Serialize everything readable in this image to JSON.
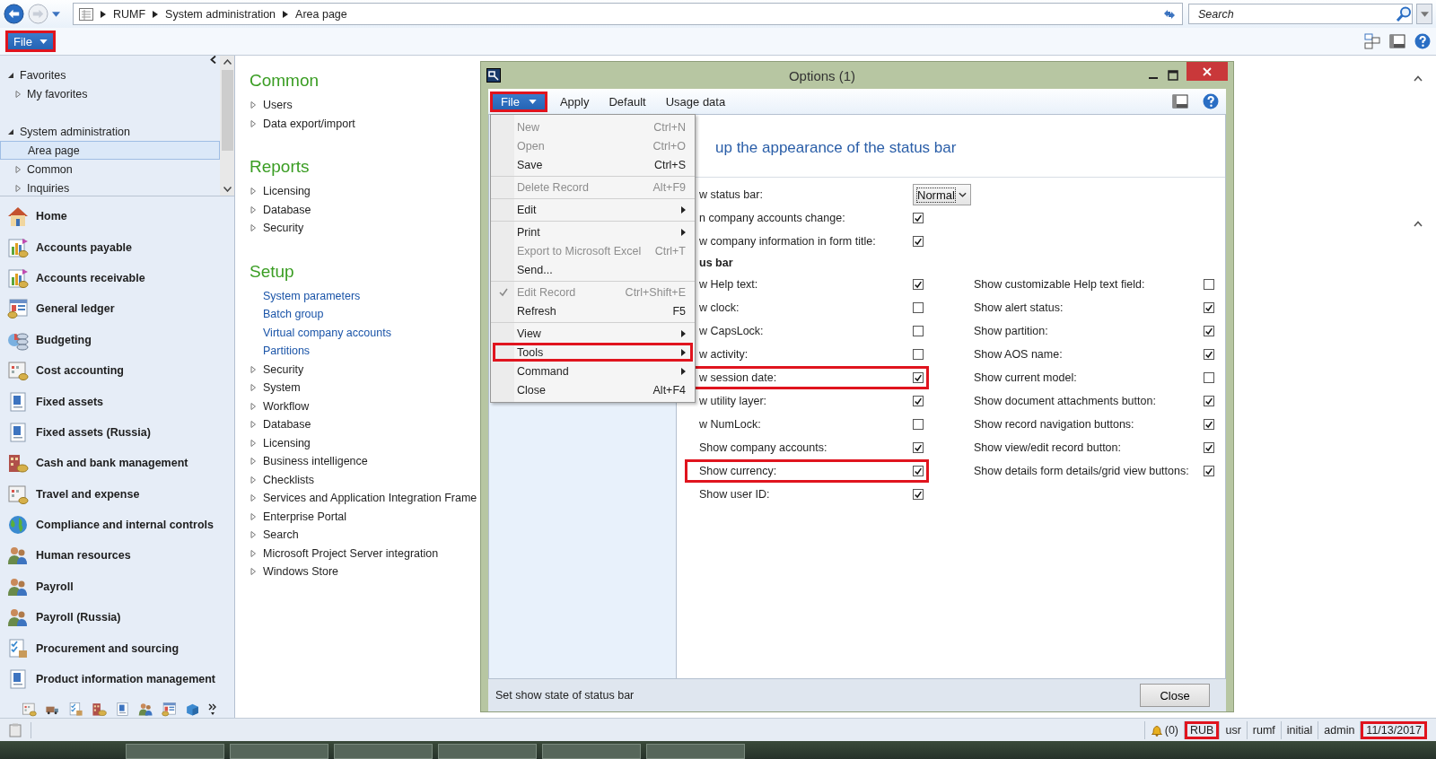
{
  "address_bar": {
    "breadcrumb": [
      "RUMF",
      "System administration",
      "Area page"
    ],
    "search": {
      "placeholder": "Search"
    }
  },
  "menu_bar": {
    "file": {
      "label": "File",
      "highlighted": true
    }
  },
  "navigation": {
    "tree": [
      {
        "label": "Favorites",
        "expanded": true,
        "children": [
          {
            "label": "My favorites",
            "expanded": false,
            "selected": false
          }
        ]
      },
      {
        "label": "System administration",
        "expanded": true,
        "children": [
          {
            "label": "Area page",
            "selected": true
          },
          {
            "label": "Common",
            "expanded": false,
            "selected": false
          },
          {
            "label": "Inquiries",
            "expanded": false,
            "selected": false
          }
        ]
      }
    ],
    "modules": [
      "Home",
      "Accounts payable",
      "Accounts receivable",
      "General ledger",
      "Budgeting",
      "Cost accounting",
      "Fixed assets",
      "Fixed assets (Russia)",
      "Cash and bank management",
      "Travel and expense",
      "Compliance and internal controls",
      "Human resources",
      "Payroll",
      "Payroll (Russia)",
      "Procurement and sourcing",
      "Product information management"
    ]
  },
  "content": {
    "sections": [
      {
        "title": "Common",
        "items": [
          {
            "label": "Users",
            "kind": "folder"
          },
          {
            "label": "Data export/import",
            "kind": "folder"
          }
        ]
      },
      {
        "title": "Reports",
        "items": [
          {
            "label": "Licensing",
            "kind": "folder"
          },
          {
            "label": "Database",
            "kind": "folder"
          },
          {
            "label": "Security",
            "kind": "folder"
          }
        ]
      },
      {
        "title": "Setup",
        "items": [
          {
            "label": "System parameters",
            "kind": "link"
          },
          {
            "label": "Batch group",
            "kind": "link"
          },
          {
            "label": "Virtual company accounts",
            "kind": "link"
          },
          {
            "label": "Partitions",
            "kind": "link"
          },
          {
            "label": "Security",
            "kind": "folder"
          },
          {
            "label": "System",
            "kind": "folder"
          },
          {
            "label": "Workflow",
            "kind": "folder"
          },
          {
            "label": "Database",
            "kind": "folder"
          },
          {
            "label": "Licensing",
            "kind": "folder"
          },
          {
            "label": "Business intelligence",
            "kind": "folder"
          },
          {
            "label": "Checklists",
            "kind": "folder"
          },
          {
            "label": "Services and Application Integration Frame",
            "kind": "folder"
          },
          {
            "label": "Enterprise Portal",
            "kind": "folder"
          },
          {
            "label": "Search",
            "kind": "folder"
          },
          {
            "label": "Microsoft Project Server integration",
            "kind": "folder"
          },
          {
            "label": "Windows Store",
            "kind": "folder"
          }
        ]
      }
    ]
  },
  "dialog": {
    "title": "Options (1)",
    "menu": [
      {
        "label": "File",
        "kind": "dropdown",
        "highlighted": true
      },
      {
        "label": "Apply",
        "kind": "command",
        "highlighted": false
      },
      {
        "label": "Default",
        "kind": "command",
        "highlighted": false
      },
      {
        "label": "Usage data",
        "kind": "command",
        "highlighted": false
      }
    ],
    "file_menu": [
      [
        {
          "label": "New",
          "shortcut": "Ctrl+N",
          "disabled": true,
          "checked": false,
          "submenu": false,
          "highlighted": false
        },
        {
          "label": "Open",
          "shortcut": "Ctrl+O",
          "disabled": true,
          "checked": false,
          "submenu": false,
          "highlighted": false
        },
        {
          "label": "Save",
          "shortcut": "Ctrl+S",
          "disabled": false,
          "checked": false,
          "submenu": false,
          "highlighted": false
        }
      ],
      [
        {
          "label": "Delete Record",
          "shortcut": "Alt+F9",
          "disabled": true,
          "checked": false,
          "submenu": false,
          "highlighted": false
        }
      ],
      [
        {
          "label": "Edit",
          "disabled": false,
          "checked": false,
          "submenu": true,
          "highlighted": false
        }
      ],
      [
        {
          "label": "Print",
          "disabled": false,
          "checked": false,
          "submenu": true,
          "highlighted": false
        },
        {
          "label": "Export to Microsoft Excel",
          "shortcut": "Ctrl+T",
          "disabled": true,
          "checked": false,
          "submenu": false,
          "highlighted": false
        },
        {
          "label": "Send...",
          "disabled": false,
          "checked": false,
          "submenu": false,
          "highlighted": false
        }
      ],
      [
        {
          "label": "Edit Record",
          "shortcut": "Ctrl+Shift+E",
          "disabled": true,
          "checked": true,
          "submenu": false,
          "highlighted": false
        },
        {
          "label": "Refresh",
          "shortcut": "F5",
          "disabled": false,
          "checked": false,
          "submenu": false,
          "highlighted": false
        }
      ],
      [
        {
          "label": "View",
          "disabled": false,
          "checked": false,
          "submenu": true,
          "highlighted": false
        },
        {
          "label": "Tools",
          "disabled": false,
          "checked": false,
          "submenu": true,
          "highlighted": true
        },
        {
          "label": "Command",
          "disabled": false,
          "checked": false,
          "submenu": true,
          "highlighted": false
        },
        {
          "label": "Close",
          "shortcut": "Alt+F4",
          "disabled": false,
          "checked": false,
          "submenu": false,
          "highlighted": false
        }
      ]
    ],
    "heading": "up the appearance of the status bar",
    "top_fields": [
      {
        "label": "w status bar:",
        "kind": "dropdown",
        "value": "Normal"
      },
      {
        "label": "n company accounts change:",
        "kind": "checkbox",
        "checked": true
      },
      {
        "label": "w company information in form title:",
        "kind": "checkbox",
        "checked": true
      }
    ],
    "group_label": "us bar",
    "left_options": [
      {
        "label": "w Help text:",
        "checked": true,
        "highlighted": false
      },
      {
        "label": "w clock:",
        "checked": false,
        "highlighted": false
      },
      {
        "label": "w CapsLock:",
        "checked": false,
        "highlighted": false
      },
      {
        "label": "w activity:",
        "checked": false,
        "highlighted": false
      },
      {
        "label": "w session date:",
        "checked": true,
        "highlighted": true
      },
      {
        "label": "w utility layer:",
        "checked": true,
        "highlighted": false
      },
      {
        "label": "w NumLock:",
        "checked": false,
        "highlighted": false
      },
      {
        "label": "Show company accounts:",
        "checked": true,
        "highlighted": false
      },
      {
        "label": "Show currency:",
        "checked": true,
        "highlighted": true
      },
      {
        "label": "Show user ID:",
        "checked": true,
        "highlighted": false
      }
    ],
    "right_options": [
      {
        "label": "Show customizable Help text field:",
        "checked": false,
        "highlighted": false
      },
      {
        "label": "Show alert status:",
        "checked": true,
        "highlighted": false
      },
      {
        "label": "Show partition:",
        "checked": true,
        "highlighted": false
      },
      {
        "label": "Show AOS name:",
        "checked": true,
        "highlighted": false
      },
      {
        "label": "Show current model:",
        "checked": false,
        "highlighted": false
      },
      {
        "label": "Show document attachments button:",
        "checked": true,
        "highlighted": false
      },
      {
        "label": "Show record navigation buttons:",
        "checked": true,
        "highlighted": false
      },
      {
        "label": "Show view/edit record button:",
        "checked": true,
        "highlighted": false
      },
      {
        "label": "Show details form details/grid view buttons:",
        "checked": true,
        "highlighted": false
      }
    ],
    "help_text": "Set show state of status bar",
    "close_button": "Close"
  },
  "status_bar": [
    {
      "label": "(0)",
      "kind": "alert",
      "highlighted": false
    },
    {
      "label": "RUB",
      "kind": "text",
      "highlighted": true
    },
    {
      "label": "usr",
      "kind": "text",
      "highlighted": false
    },
    {
      "label": "rumf",
      "kind": "text",
      "highlighted": false
    },
    {
      "label": "initial",
      "kind": "text",
      "highlighted": false
    },
    {
      "label": "admin",
      "kind": "text",
      "highlighted": false
    },
    {
      "label": "11/13/2017",
      "kind": "text",
      "highlighted": true
    }
  ]
}
